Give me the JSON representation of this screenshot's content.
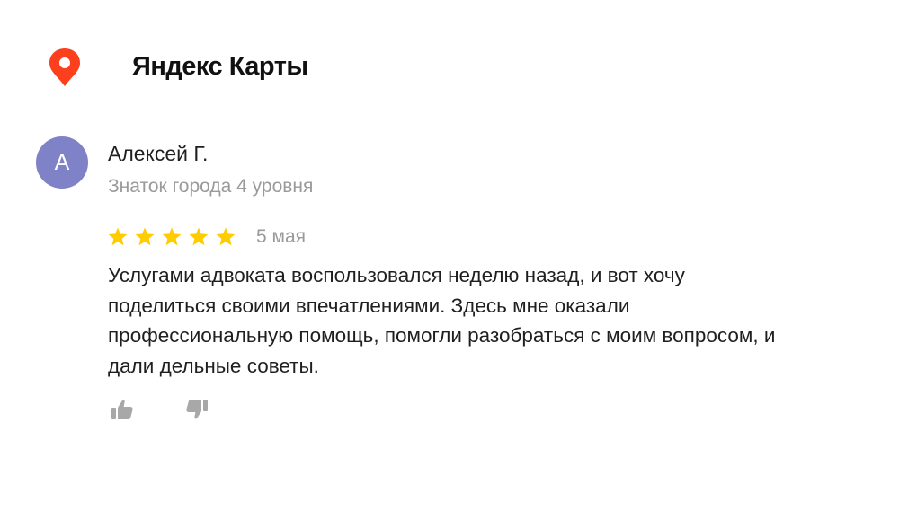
{
  "header": {
    "brand": "Яндекс Карты",
    "logo_icon": "map-pin-icon",
    "accent_color": "#fc3f1d"
  },
  "review": {
    "author": {
      "avatar_letter": "А",
      "avatar_color": "#7f82c6",
      "name": "Алексей Г.",
      "level": "Знаток города 4 уровня"
    },
    "rating": 5,
    "rating_max": 5,
    "star_color": "#ffcc00",
    "date": "5 мая",
    "text": "Услугами адвоката воспользовался неделю назад, и вот хочу поделиться своими впечатлениями. Здесь мне оказали профессиональную помощь, помогли разобраться с моим вопросом, и дали дельные советы.",
    "actions": {
      "like_icon": "thumbs-up-icon",
      "dislike_icon": "thumbs-down-icon"
    }
  }
}
